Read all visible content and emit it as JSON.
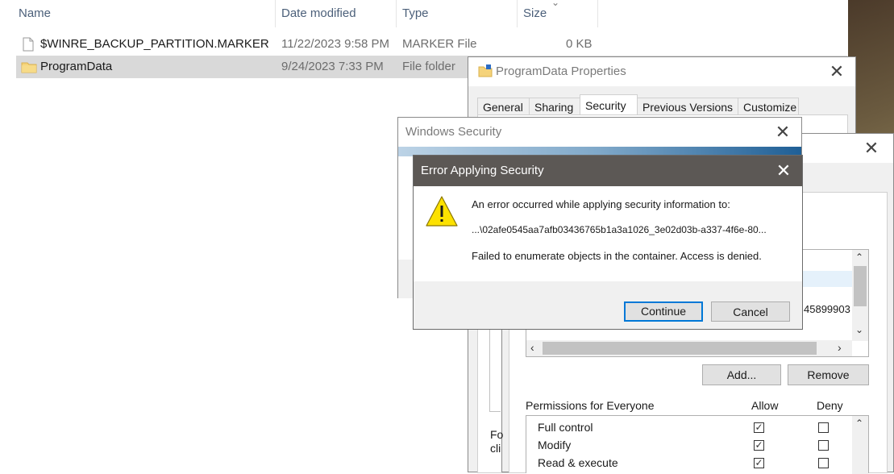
{
  "explorer": {
    "columns": {
      "name": "Name",
      "date": "Date modified",
      "type": "Type",
      "size": "Size"
    },
    "rows": [
      {
        "name": "$WINRE_BACKUP_PARTITION.MARKER",
        "date": "11/22/2023 9:58 PM",
        "type": "MARKER File",
        "size": "0 KB"
      },
      {
        "name": "ProgramData",
        "date": "9/24/2023 7:33 PM",
        "type": "File folder",
        "size": ""
      }
    ]
  },
  "properties": {
    "title": "ProgramData Properties",
    "tabs": [
      "General",
      "Sharing",
      "Security",
      "Previous Versions",
      "Customize"
    ],
    "active_tab": "Security"
  },
  "permissions_dialog": {
    "list_fragment": "45899903",
    "add_label": "Add...",
    "remove_label": "Remove",
    "permissions_for": "Permissions for Everyone",
    "allow_header": "Allow",
    "deny_header": "Deny",
    "perms": [
      {
        "name": "Full control",
        "allow": true,
        "deny": false
      },
      {
        "name": "Modify",
        "allow": true,
        "deny": false
      },
      {
        "name": "Read & execute",
        "allow": true,
        "deny": false
      }
    ],
    "fragment_1": "Fo",
    "fragment_2": "cli"
  },
  "windows_security": {
    "title": "Windows Security"
  },
  "error_dialog": {
    "title": "Error Applying Security",
    "line1": "An error occurred while applying security information to:",
    "path": "...\\02afe0545aa7afb03436765b1a3a1026_3e02d03b-a337-4f6e-80...",
    "line3": "Failed to enumerate objects in the container. Access is denied.",
    "continue_label": "Continue",
    "cancel_label": "Cancel"
  },
  "colors": {
    "accent": "#0078d7",
    "error_titlebar": "#5c5855",
    "warning": "#fce100"
  }
}
